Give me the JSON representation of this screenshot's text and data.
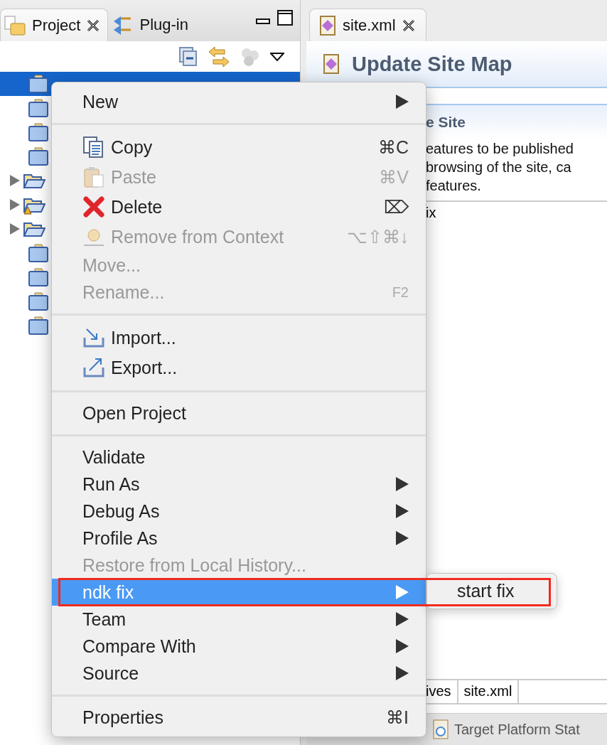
{
  "left_panel": {
    "tabs": [
      {
        "label": "Project",
        "selected": true
      },
      {
        "label": "Plug-in",
        "selected": false
      }
    ],
    "tree": [
      {
        "kind": "closed",
        "selected": true
      },
      {
        "kind": "closed",
        "selected": false
      },
      {
        "kind": "closed",
        "selected": false
      },
      {
        "kind": "closed",
        "selected": false
      },
      {
        "kind": "open",
        "selected": false
      },
      {
        "kind": "open-warning",
        "selected": false
      },
      {
        "kind": "open",
        "selected": false
      },
      {
        "kind": "closed",
        "selected": false
      },
      {
        "kind": "closed",
        "selected": false
      },
      {
        "kind": "closed",
        "selected": false
      },
      {
        "kind": "closed",
        "selected": false
      }
    ]
  },
  "editor": {
    "tabs": [
      {
        "label": "site.xml",
        "selected": true
      }
    ],
    "title": "Update Site Map",
    "section_title": "e Site",
    "description_lines": [
      "eatures to be published",
      "browsing of the site, ca",
      "features."
    ],
    "list_item": "ix",
    "page_tabs": [
      "ives",
      "site.xml"
    ],
    "view_tabs": [
      "Target Platform Stat"
    ]
  },
  "context_menu": {
    "items": [
      {
        "kind": "plain",
        "label": "New",
        "submenu": true,
        "disabled": false,
        "selected": false
      },
      {
        "kind": "separator"
      },
      {
        "kind": "copy",
        "label": "Copy",
        "shortcut": "⌘C",
        "submenu": false,
        "disabled": false,
        "selected": false
      },
      {
        "kind": "paste",
        "label": "Paste",
        "shortcut": "⌘V",
        "submenu": false,
        "disabled": true,
        "selected": false
      },
      {
        "kind": "delete",
        "label": "Delete",
        "shortcut": "⌦",
        "submenu": false,
        "disabled": false,
        "selected": false
      },
      {
        "kind": "remove",
        "label": "Remove from Context",
        "shortcut": "⌥⇧⌘↓",
        "submenu": false,
        "disabled": true,
        "selected": false
      },
      {
        "kind": "plain",
        "label": "Move...",
        "submenu": false,
        "disabled": true,
        "selected": false
      },
      {
        "kind": "plain",
        "label": "Rename...",
        "shortcut": "F2",
        "submenu": false,
        "disabled": true,
        "selected": false
      },
      {
        "kind": "separator"
      },
      {
        "kind": "import",
        "label": "Import...",
        "submenu": false,
        "disabled": false,
        "selected": false
      },
      {
        "kind": "export",
        "label": "Export...",
        "submenu": false,
        "disabled": false,
        "selected": false
      },
      {
        "kind": "separator"
      },
      {
        "kind": "plain",
        "label": "Open Project",
        "submenu": false,
        "disabled": false,
        "selected": false
      },
      {
        "kind": "separator"
      },
      {
        "kind": "plain",
        "label": "Validate",
        "submenu": false,
        "disabled": false,
        "selected": false
      },
      {
        "kind": "plain",
        "label": "Run As",
        "submenu": true,
        "disabled": false,
        "selected": false
      },
      {
        "kind": "plain",
        "label": "Debug As",
        "submenu": true,
        "disabled": false,
        "selected": false
      },
      {
        "kind": "plain",
        "label": "Profile As",
        "submenu": true,
        "disabled": false,
        "selected": false
      },
      {
        "kind": "plain",
        "label": "Restore from Local History...",
        "submenu": false,
        "disabled": true,
        "selected": false
      },
      {
        "kind": "plain",
        "label": "ndk fix",
        "submenu": true,
        "disabled": false,
        "selected": true
      },
      {
        "kind": "plain",
        "label": "Team",
        "submenu": true,
        "disabled": false,
        "selected": false
      },
      {
        "kind": "plain",
        "label": "Compare With",
        "submenu": true,
        "disabled": false,
        "selected": false
      },
      {
        "kind": "plain",
        "label": "Source",
        "submenu": true,
        "disabled": false,
        "selected": false
      },
      {
        "kind": "separator"
      },
      {
        "kind": "plain",
        "label": "Properties",
        "shortcut": "⌘I",
        "submenu": false,
        "disabled": false,
        "selected": false
      }
    ]
  },
  "submenu": {
    "items": [
      {
        "label": "start fix",
        "selected": false
      }
    ]
  }
}
